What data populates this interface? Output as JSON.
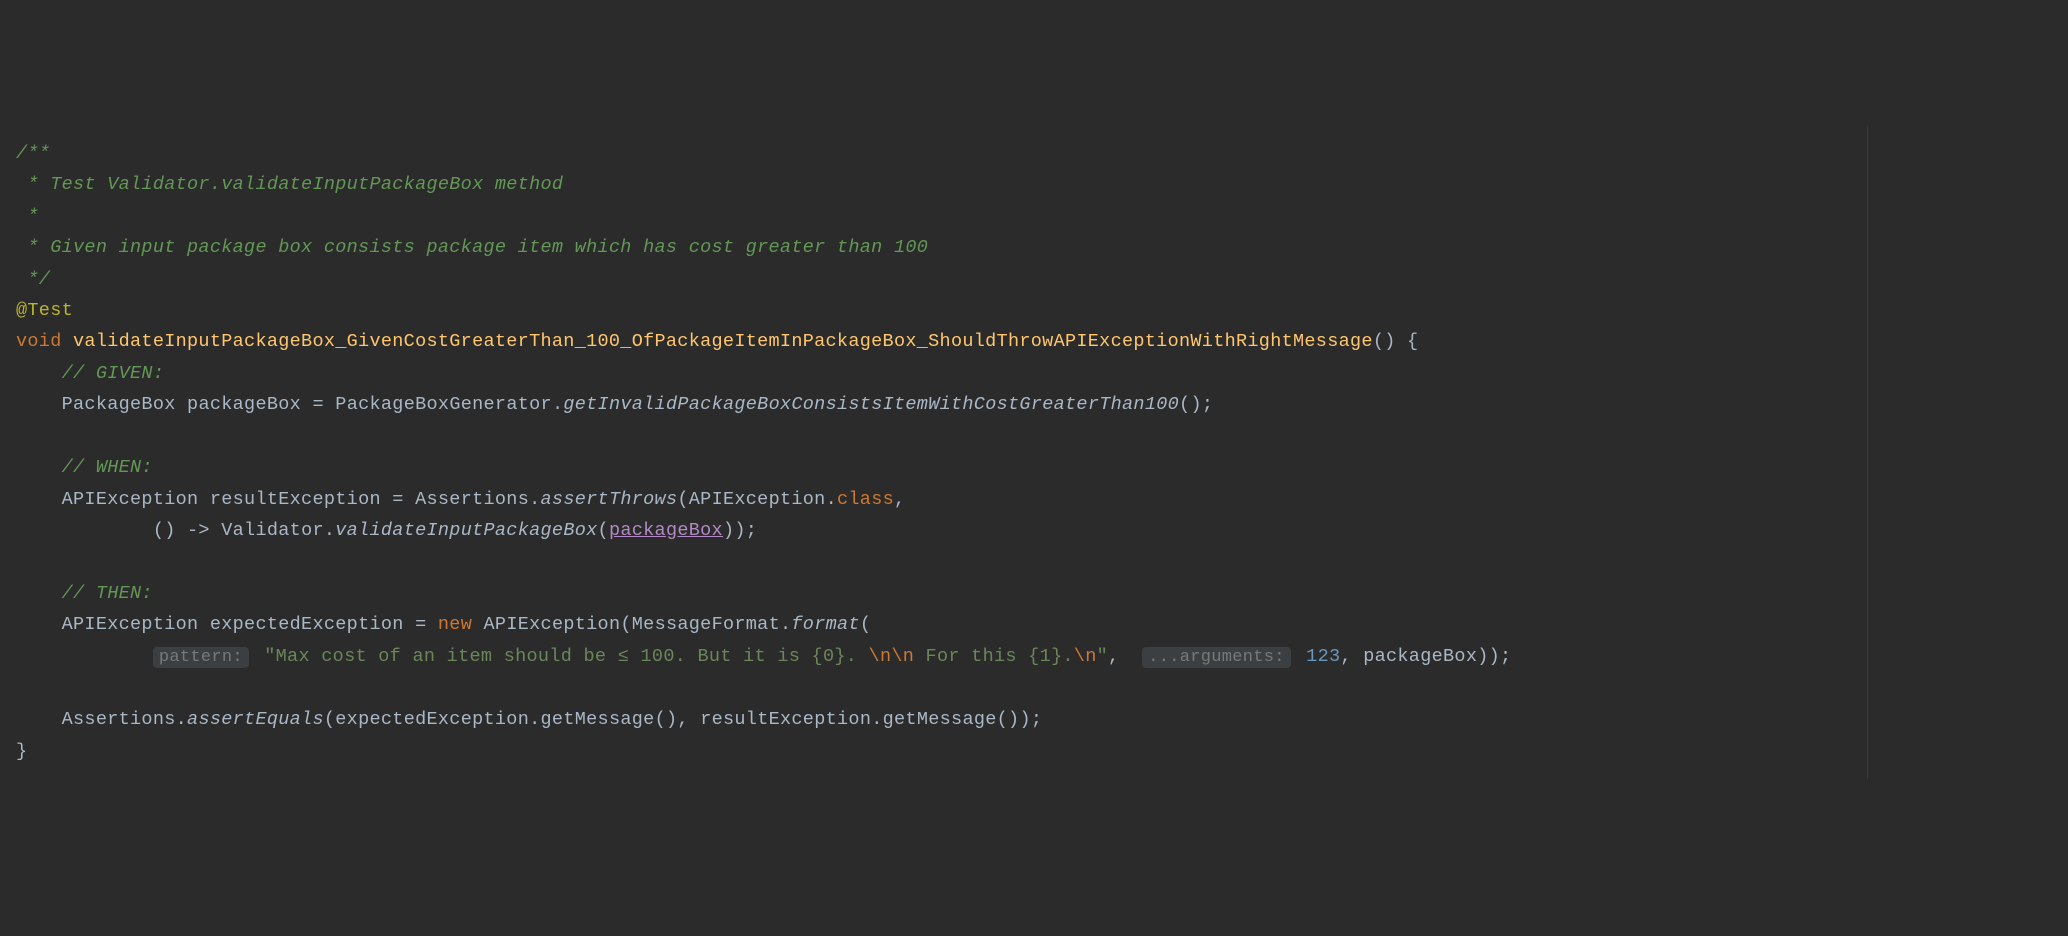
{
  "code": {
    "comment1": "/**",
    "comment2": " * Test Validator.validateInputPackageBox method",
    "comment3": " *",
    "comment4": " * Given input package box consists package item which has cost greater than 100",
    "comment5": " */",
    "annotation": "@Test",
    "void": "void",
    "methodName": "validateInputPackageBox_GivenCostGreaterThan_100_OfPackageItemInPackageBox_ShouldThrowAPIExceptionWithRightMessage",
    "given": "// GIVEN:",
    "packageBoxType": "PackageBox",
    "packageBoxVar": "packageBox",
    "eq": "=",
    "packageBoxGen": "PackageBoxGenerator",
    "getInvalid": "getInvalidPackageBoxConsistsItemWithCostGreaterThan100",
    "when": "// WHEN:",
    "apiExceptionType": "APIException",
    "resultException": "resultException",
    "assertions": "Assertions",
    "assertThrows": "assertThrows",
    "classKw": "class",
    "arrow": "() ->",
    "validator": "Validator",
    "validateMethod": "validateInputPackageBox",
    "packageBoxParam": "packageBox",
    "then": "// THEN:",
    "expectedException": "expectedException",
    "newKw": "new",
    "messageFormat": "MessageFormat",
    "formatMethod": "format",
    "hintPattern": "pattern:",
    "stringPart1": "\"Max cost of an item should be ≤ 100. But it is {0}. ",
    "escape1": "\\n\\n",
    "stringPart2": " For this {1}.",
    "escape2": "\\n",
    "stringPart3": "\"",
    "hintArgs": "...arguments:",
    "num123": "123",
    "assertEquals": "assertEquals",
    "getMessage": "getMessage"
  }
}
